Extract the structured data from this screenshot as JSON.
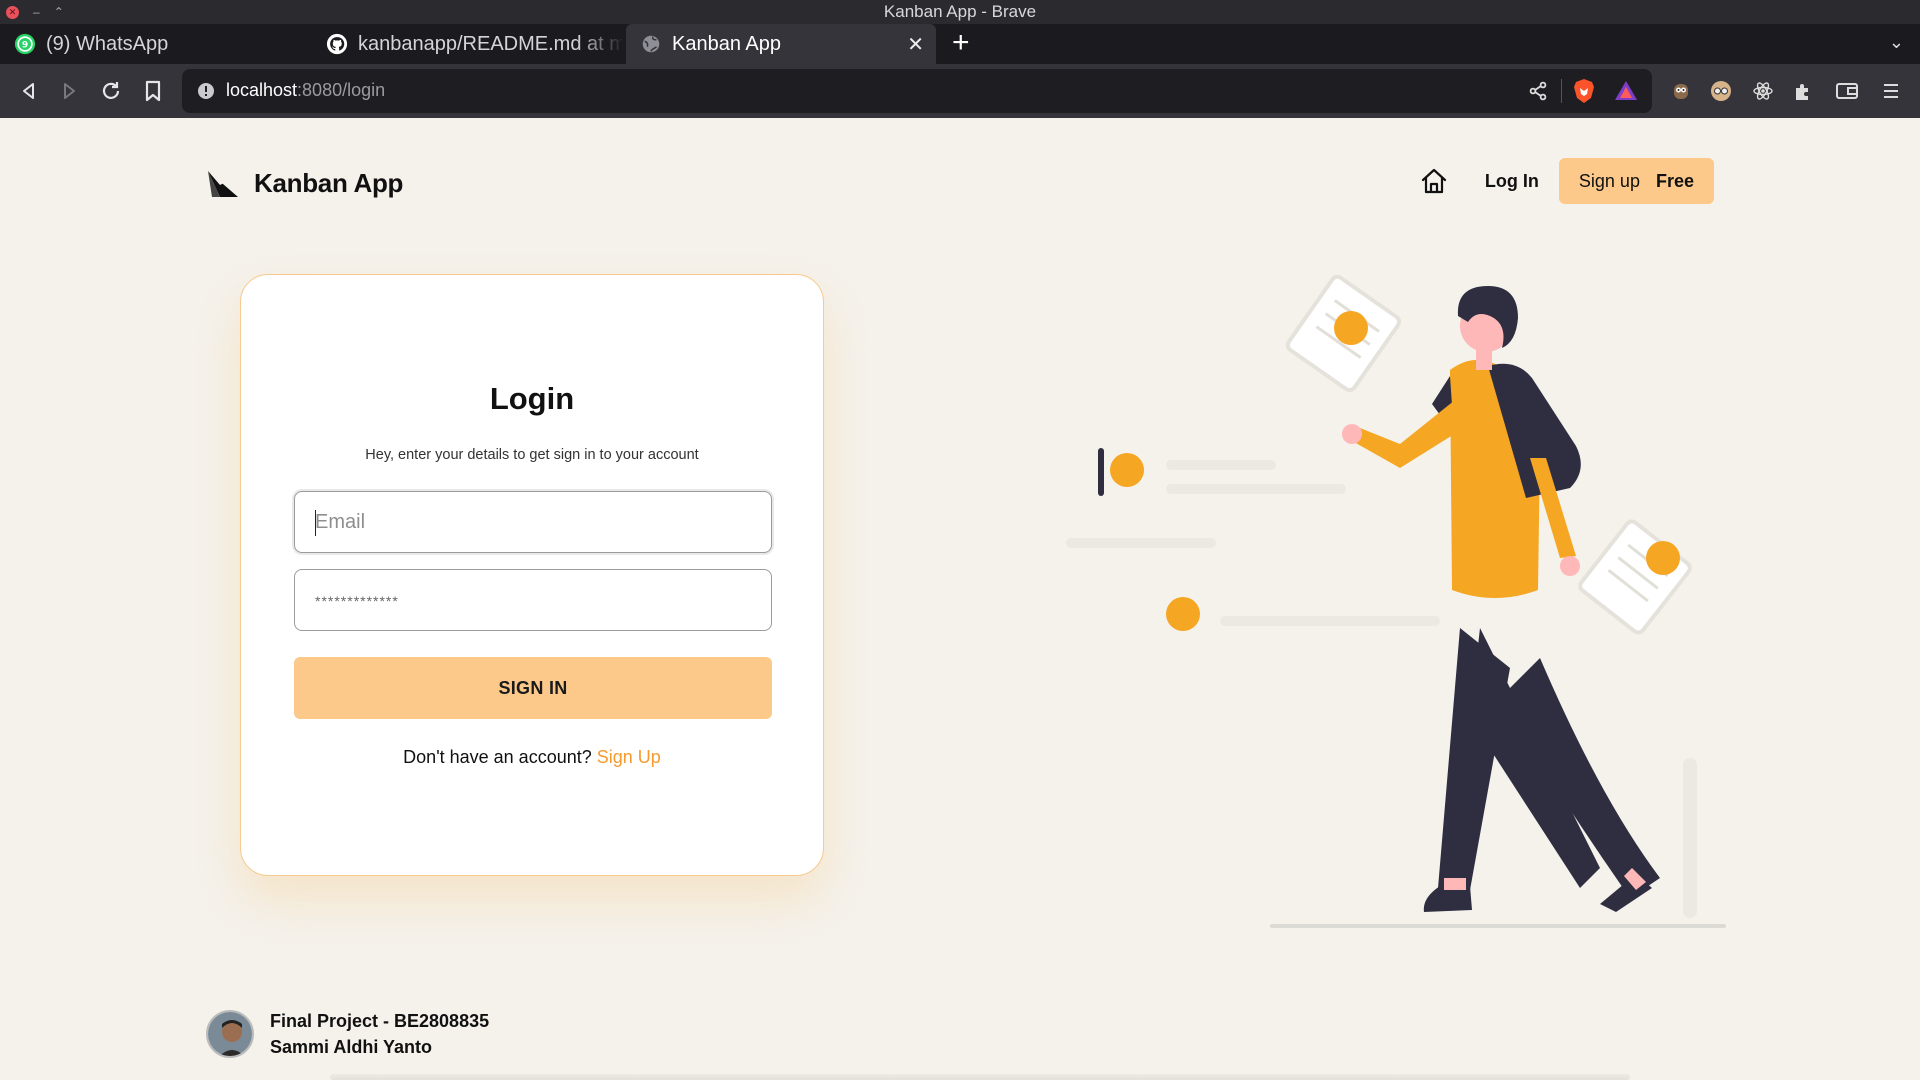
{
  "browser": {
    "window_title": "Kanban App - Brave",
    "tabs": [
      {
        "label": "(9) WhatsApp",
        "icon": "whatsapp-icon"
      },
      {
        "label": "kanbanapp/README.md at main",
        "icon": "github-icon"
      },
      {
        "label": "Kanban App",
        "icon": "globe-icon",
        "active": true
      }
    ],
    "url_host": "localhost",
    "url_rest": ":8080/login"
  },
  "header": {
    "brand": "Kanban App",
    "login_label": "Log In",
    "signup_label": "Sign up",
    "signup_emphasis": "Free"
  },
  "login": {
    "title": "Login",
    "subtitle": "Hey, enter your details to get sign in to your account",
    "email_placeholder": "Email",
    "password_placeholder": "*************",
    "submit_label": "SIGN IN",
    "no_account_text": "Don't have an account?",
    "signup_link": "Sign Up"
  },
  "footer": {
    "line1": "Final Project - BE2808835",
    "line2": "Sammi Aldhi Yanto"
  },
  "colors": {
    "accent": "#fcc98a",
    "link": "#f59b2e",
    "illustration_yellow": "#f5a623",
    "illustration_dark": "#2f2e41",
    "background": "#f5f2ec"
  }
}
